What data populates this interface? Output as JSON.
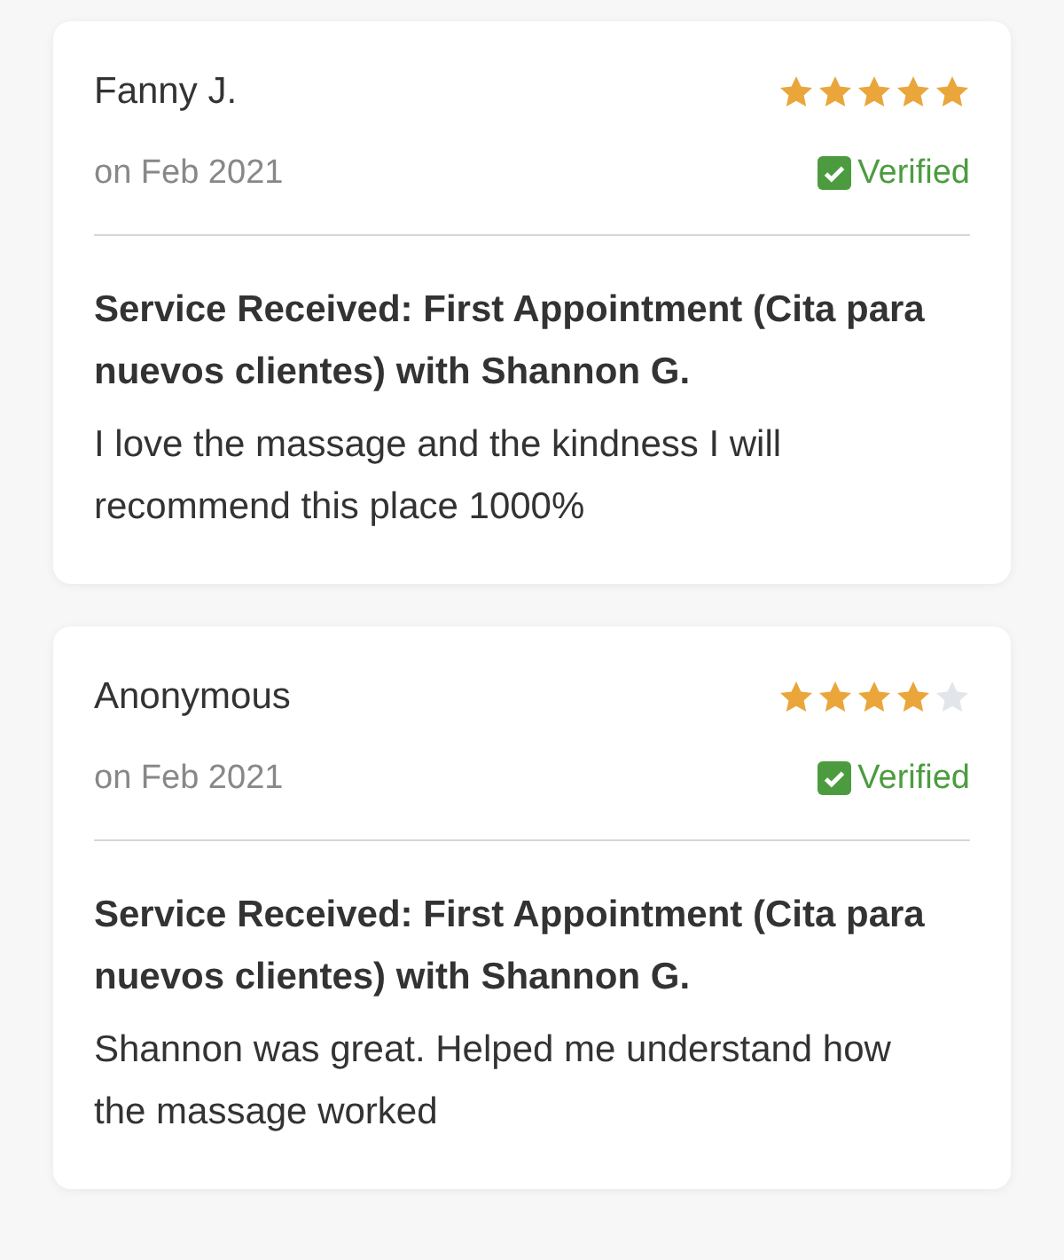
{
  "reviews": [
    {
      "author": "Fanny J.",
      "stars": 5,
      "date": "on Feb 2021",
      "verified": true,
      "verified_label": "Verified",
      "service": "Service Received: First Appointment (Cita para nuevos clientes) with Shannon G.",
      "text": "I love the massage and the kindness I will recommend this place 1000%"
    },
    {
      "author": "Anonymous",
      "stars": 4,
      "date": "on Feb 2021",
      "verified": true,
      "verified_label": "Verified",
      "service": "Service Received: First Appointment (Cita para nuevos clientes) with Shannon G.",
      "text": "Shannon was great. Helped me understand how the massage worked"
    }
  ]
}
